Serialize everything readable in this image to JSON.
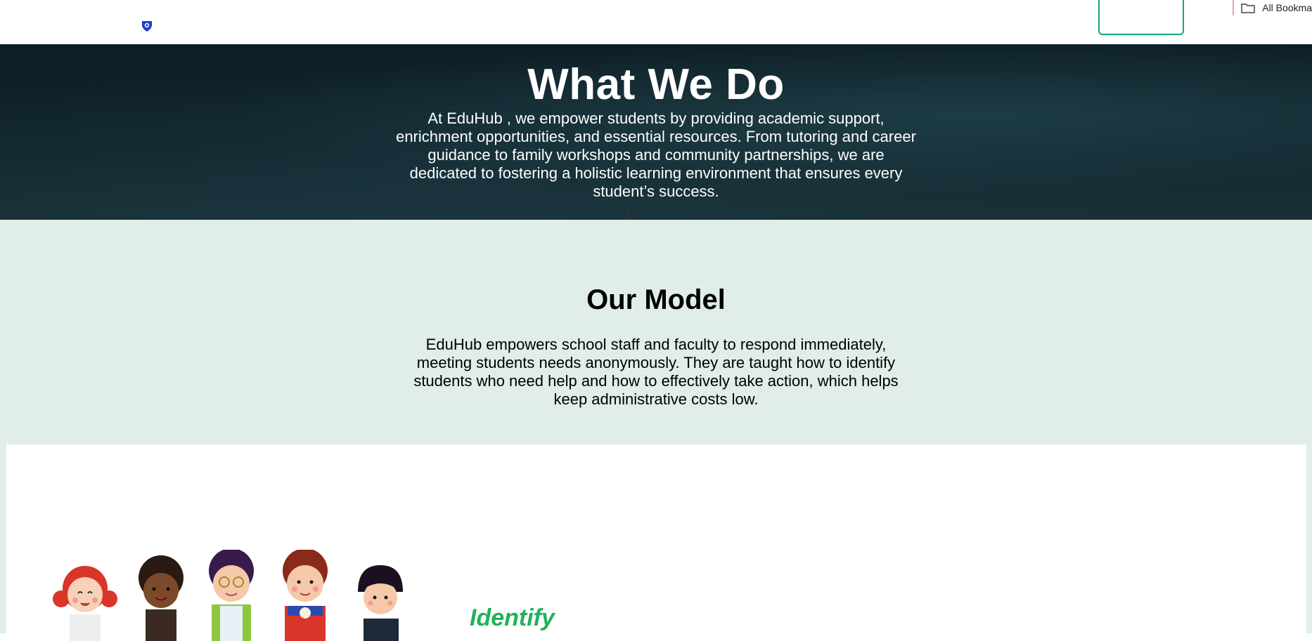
{
  "browser": {
    "bookmarks_label": "All Bookma"
  },
  "hero": {
    "title": "What We Do",
    "text": "At EduHub , we empower students by providing academic support, enrichment opportunities, and essential resources. From tutoring and career guidance to family workshops and community partnerships, we are dedicated to fostering a holistic learning environment that ensures every student’s success."
  },
  "model": {
    "title": "Our Model",
    "text": "EduHub empowers school staff and faculty to respond immediately, meeting students needs anonymously. They are taught how to identify students who need help and how to effectively take action, which helps keep administrative costs low."
  },
  "steps": {
    "identify_label": "Identify"
  },
  "colors": {
    "hero_bg": "#12262e",
    "section_bg": "#e1ede7",
    "accent_green": "#1fb25a",
    "button_border": "#1aa37a"
  },
  "icons": {
    "logo": "shield-logo-icon",
    "bookmarks_folder": "folder-icon",
    "cursor": "text-cursor-icon"
  }
}
